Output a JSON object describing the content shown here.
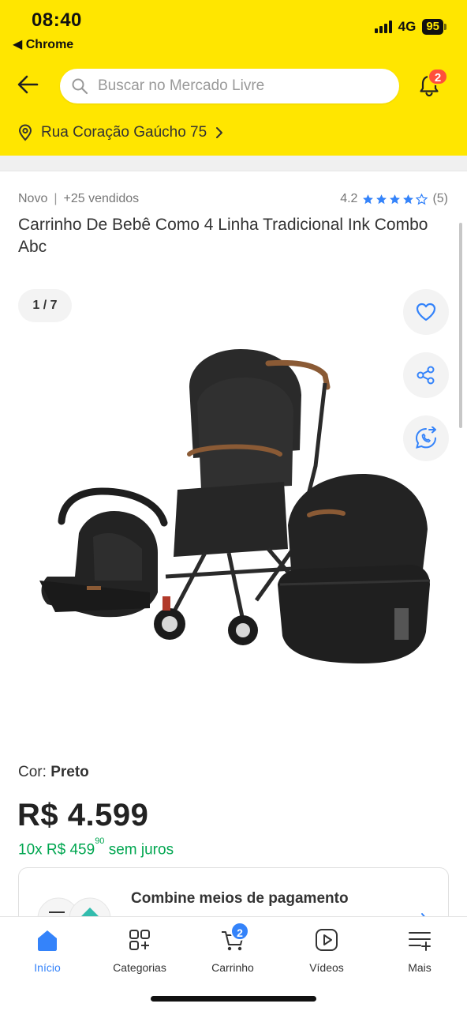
{
  "status_bar": {
    "time": "08:40",
    "back_app": "◀ Chrome",
    "network": "4G",
    "battery": "95"
  },
  "header": {
    "search_placeholder": "Buscar no Mercado Livre",
    "notifications_count": "2",
    "address": "Rua Coração Gaúcho 75",
    "background_color": "#ffe600"
  },
  "product": {
    "condition": "Novo",
    "sold": "+25 vendidos",
    "rating_value": "4.2",
    "rating_count": "(5)",
    "stars_filled": 4,
    "title": "Carrinho De Bebê Como 4 Linha Tradicional Ink Combo Abc",
    "image_counter": "1 / 7",
    "color_label": "Cor:",
    "color_value": "Preto",
    "price": "R$ 4.599",
    "installments_prefix": "10x R$ 459",
    "installments_cents": "90",
    "installments_suffix": "sem juros"
  },
  "payment_card": {
    "title": "Combine meios de pagamento"
  },
  "tabbar": {
    "items": [
      {
        "label": "Início",
        "icon": "home-icon",
        "active": true
      },
      {
        "label": "Categorias",
        "icon": "categories-icon",
        "active": false
      },
      {
        "label": "Carrinho",
        "icon": "cart-icon",
        "active": false
      },
      {
        "label": "Vídeos",
        "icon": "videos-icon",
        "active": false
      },
      {
        "label": "Mais",
        "icon": "more-icon",
        "active": false
      }
    ],
    "cart_count": "2"
  },
  "colors": {
    "accent_blue": "#3483fa",
    "green": "#00a650",
    "badge_red": "#ff4f3b"
  }
}
